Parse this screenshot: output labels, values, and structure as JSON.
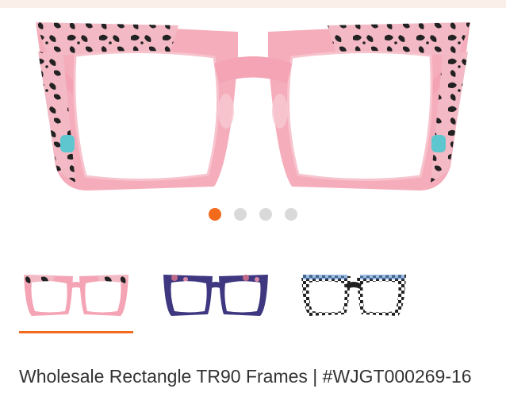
{
  "product": {
    "title": "Wholesale Rectangle TR90 Frames  |  #WJGT000269-16"
  },
  "carousel": {
    "total_slides": 4,
    "active_index": 0
  },
  "colors": {
    "accent": "#f26a1b",
    "dot_inactive": "#d9d9d9",
    "frame_pink": "#f2a6b3",
    "frame_purple": "#3f3780"
  },
  "thumbnails": [
    {
      "variant": "pink-leopard",
      "selected": true
    },
    {
      "variant": "purple-tortoise",
      "selected": false
    },
    {
      "variant": "black-white-check",
      "selected": false
    }
  ]
}
